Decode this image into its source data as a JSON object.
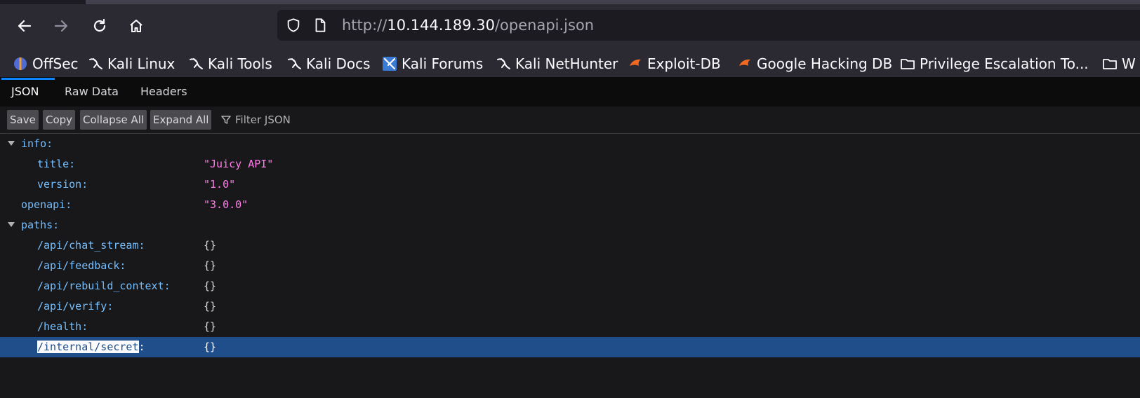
{
  "browser": {
    "url_scheme": "http://",
    "url_host": "10.144.189.30",
    "url_path": "/openapi.json"
  },
  "bookmarks": [
    {
      "label": "OffSec",
      "icon": "offsec-icon"
    },
    {
      "label": "Kali Linux",
      "icon": "kali-dragon-icon"
    },
    {
      "label": "Kali Tools",
      "icon": "kali-dragon-icon"
    },
    {
      "label": "Kali Docs",
      "icon": "kali-dragon-icon"
    },
    {
      "label": "Kali Forums",
      "icon": "kali-forums-icon"
    },
    {
      "label": "Kali NetHunter",
      "icon": "kali-dragon-icon"
    },
    {
      "label": "Exploit-DB",
      "icon": "exploit-db-icon"
    },
    {
      "label": "Google Hacking DB",
      "icon": "exploit-db-icon"
    },
    {
      "label": "Privilege Escalation To...",
      "icon": "folder-icon"
    },
    {
      "label": "W",
      "icon": "folder-icon"
    }
  ],
  "viewer_tabs": [
    "JSON",
    "Raw Data",
    "Headers"
  ],
  "toolbar": {
    "save": "Save",
    "copy": "Copy",
    "collapse_all": "Collapse All",
    "expand_all": "Expand All",
    "filter_placeholder": "Filter JSON"
  },
  "tree": {
    "info_key": "info",
    "info": [
      {
        "key": "title",
        "value": "\"Juicy API\""
      },
      {
        "key": "version",
        "value": "\"1.0\""
      }
    ],
    "openapi_key": "openapi",
    "openapi_value": "\"3.0.0\"",
    "paths_key": "paths",
    "paths": [
      {
        "key": "/api/chat_stream",
        "value": "{}"
      },
      {
        "key": "/api/feedback",
        "value": "{}"
      },
      {
        "key": "/api/rebuild_context",
        "value": "{}"
      },
      {
        "key": "/api/verify",
        "value": "{}"
      },
      {
        "key": "/health",
        "value": "{}"
      },
      {
        "key": "/internal/secret",
        "value": "{}"
      }
    ]
  },
  "colors": {
    "accent": "#0a84ff",
    "selection": "#204e8a",
    "json_key": "#75bfff",
    "json_string": "#ff7de9"
  }
}
